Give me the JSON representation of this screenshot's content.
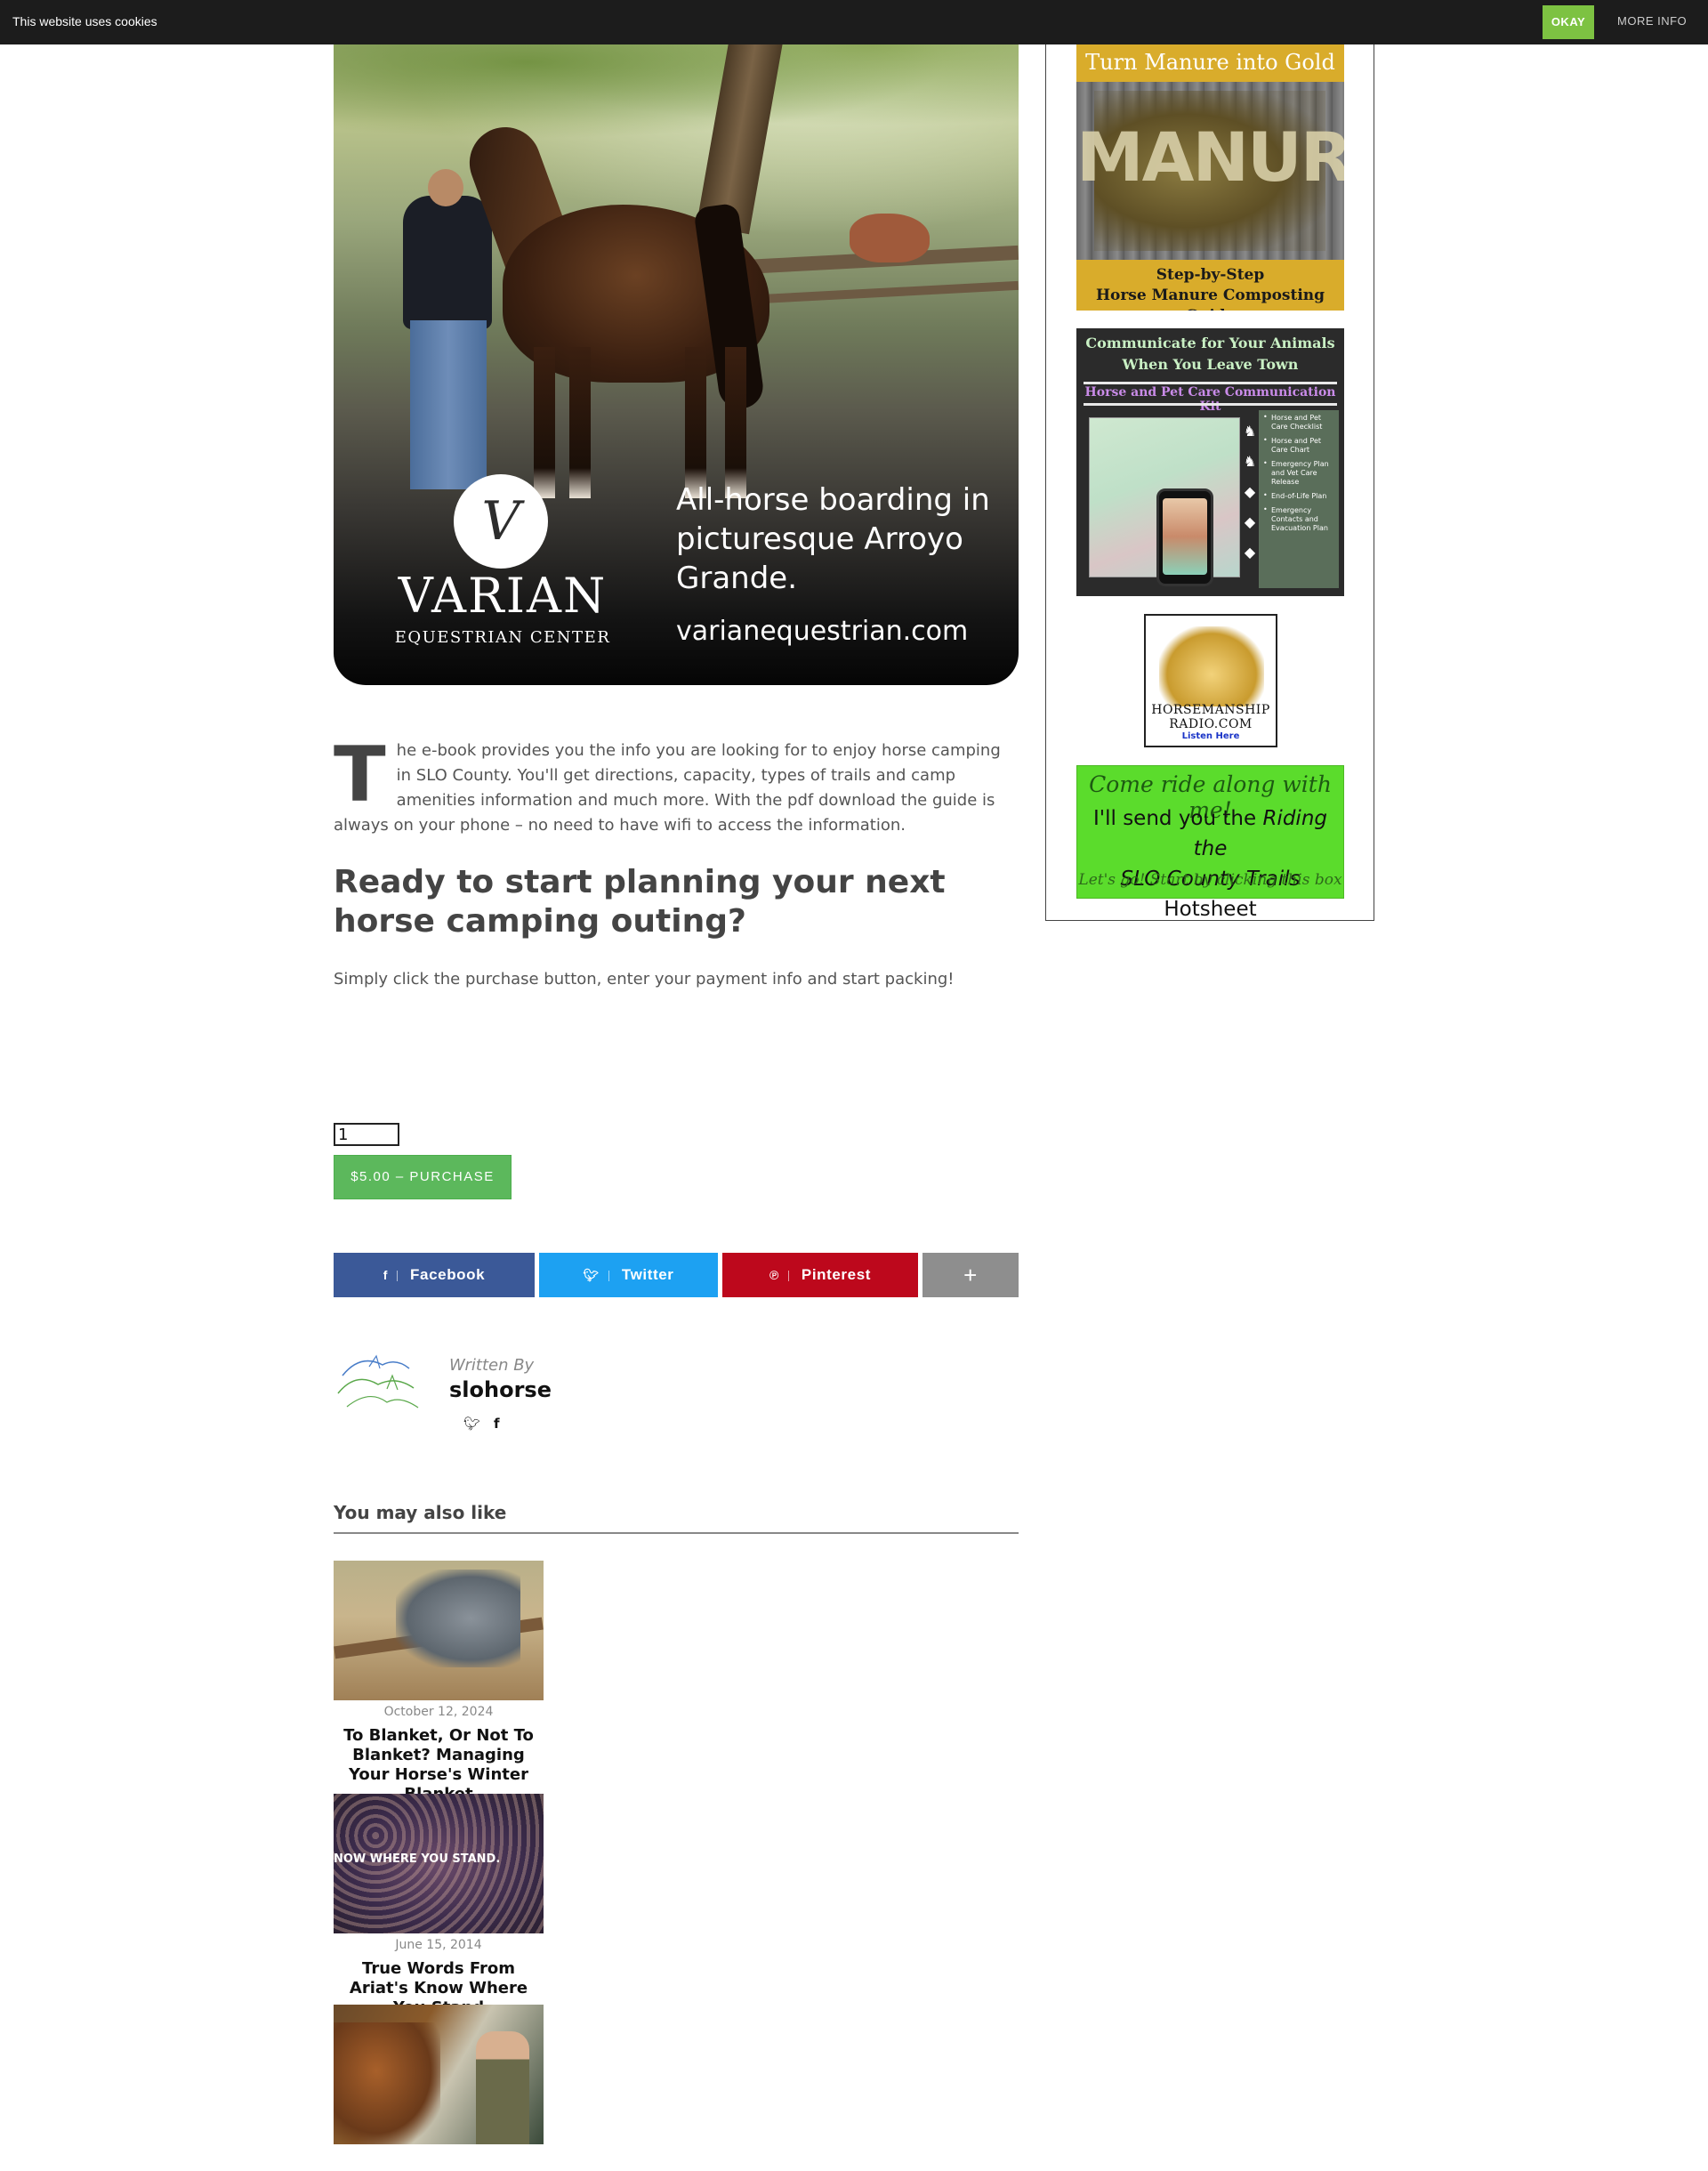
{
  "cookie": {
    "text": "This website uses cookies",
    "okay": "OKAY",
    "more": "MORE INFO"
  },
  "hero_ad": {
    "logo_mark": "V",
    "brand": "VARIAN",
    "brand_sub": "EQUESTRIAN CENTER",
    "tagline": "All-horse boarding in picturesque Arroyo Grande.",
    "url": "varianequestrian.com"
  },
  "sidebar": {
    "ad_manure": {
      "top": "Turn Manure into Gold",
      "word": "MANURE",
      "bottom_line1": "Step-by-Step",
      "bottom_line2": "Horse Manure Composting Guide"
    },
    "ad_kit": {
      "title_line1": "Communicate for Your Animals",
      "title_line2": "When You Leave Town",
      "kit_title": "Horse and Pet Care Communication Kit",
      "items": [
        "Horse and Pet Care Checklist",
        "Horse and Pet Care Chart",
        "Emergency Plan and Vet Care Release",
        "End-of-Life Plan",
        "Emergency Contacts and Evacuation Plan"
      ]
    },
    "ad_radio": {
      "line1": "HORSEMANSHIP",
      "line2": "RADIO.COM",
      "line3": "Listen Here"
    },
    "ad_ride": {
      "line1": "Come ride along with me!",
      "line2a": "I'll send you the ",
      "line2b": "Riding the",
      "line3a": "SLO County Trails",
      "line3b": " Hotsheet",
      "line4": "Let's go! Start by clicking this box"
    }
  },
  "article": {
    "dropcap": "T",
    "paragraph": "he e-book provides you the info you are looking for to enjoy horse camping in SLO County. You'll get directions, capacity, types of trails and camp amenities information and much more. With the pdf download the guide is always on your phone – no need to have wifi to access the information.",
    "heading": "Ready to start planning your next horse camping outing?",
    "instruction": "Simply click the purchase button, enter your payment info and start packing!",
    "quantity": "1",
    "purchase_label": "$5.00 – PURCHASE"
  },
  "share": {
    "facebook": "Facebook",
    "twitter": "Twitter",
    "pinterest": "Pinterest",
    "more": "+"
  },
  "author": {
    "written_by": "Written By",
    "name": "slohorse"
  },
  "related": {
    "heading": "You may also like",
    "items": [
      {
        "date": "October 12, 2024",
        "title": "To Blanket, Or Not To Blanket? Managing Your Horse's Winter Blanket"
      },
      {
        "date": "June 15, 2014",
        "title": "True Words From Ariat's Know Where You Stand",
        "image_caption": "NOW WHERE YOU STAND."
      }
    ]
  },
  "icons": [
    "facebook-icon",
    "twitter-icon",
    "pinterest-icon",
    "plus-icon"
  ],
  "colors": {
    "facebook": "#3b5998",
    "twitter": "#1da1f2",
    "pinterest": "#bd081c",
    "more": "#8e8e8e",
    "purchase": "#5cb85c",
    "cookie_okay": "#7dc242"
  }
}
